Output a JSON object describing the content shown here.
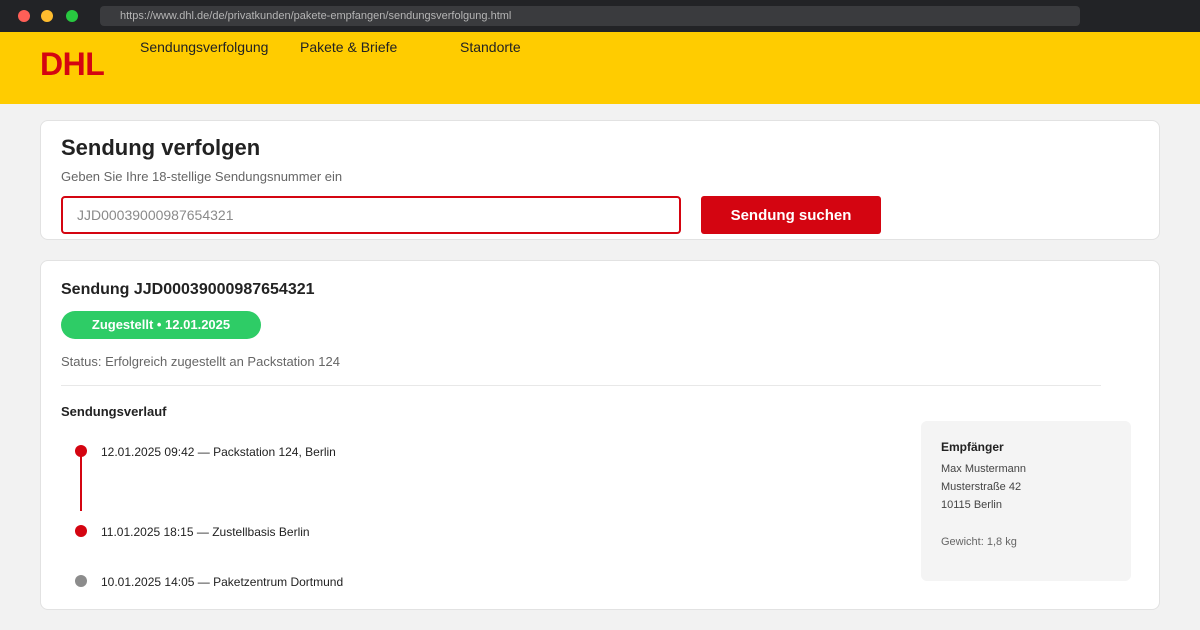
{
  "browser": {
    "url": "https://www.dhl.de/de/privatkunden/pakete-empfangen/sendungsverfolgung.html"
  },
  "header": {
    "logo": "DHL",
    "nav": [
      "Sendungsverfolgung",
      "Pakete & Briefe",
      "Standorte"
    ]
  },
  "search": {
    "title": "Sendung verfolgen",
    "subtitle": "Geben Sie Ihre 18-stellige Sendungsnummer ein",
    "input_value": "JJD00039000987654321",
    "button_label": "Sendung suchen"
  },
  "result": {
    "title": "Sendung JJD00039000987654321",
    "badge": "Zugestellt • 12.01.2025",
    "status": "Status: Erfolgreich zugestellt an Packstation 124",
    "history_title": "Sendungsverlauf",
    "history": [
      "12.01.2025 09:42 — Packstation 124, Berlin",
      "11.01.2025 18:15 — Zustellbasis Berlin",
      "10.01.2025 14:05 — Paketzentrum Dortmund"
    ]
  },
  "recipient": {
    "title": "Empfänger",
    "lines": [
      "Max Mustermann",
      "Musterstraße 42",
      "10115 Berlin"
    ],
    "weight": "Gewicht: 1,8 kg"
  },
  "colors": {
    "brand_yellow": "#ffcc00",
    "brand_red": "#d40511",
    "success_green": "#2ecc66"
  }
}
